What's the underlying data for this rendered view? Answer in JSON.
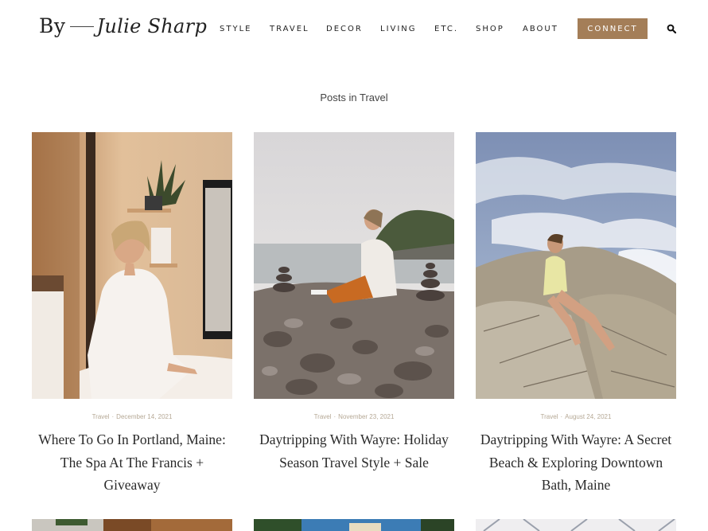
{
  "header": {
    "logo": {
      "by": "By",
      "name": "Julie Sharp"
    },
    "nav": [
      "STYLE",
      "TRAVEL",
      "DECOR",
      "LIVING",
      "ETC.",
      "SHOP",
      "ABOUT"
    ],
    "connect_label": "CONNECT",
    "search_icon": "search-icon"
  },
  "page": {
    "heading": "Posts in Travel"
  },
  "posts": [
    {
      "category": "Travel",
      "date": "December 14, 2021",
      "title": "Where To Go In Portland, Maine: The Spa At The Francis + Giveaway"
    },
    {
      "category": "Travel",
      "date": "November 23, 2021",
      "title": "Daytripping With Wayre: Holiday Season Travel Style + Sale"
    },
    {
      "category": "Travel",
      "date": "August 24, 2021",
      "title": "Daytripping With Wayre: A Secret Beach & Exploring Downtown Bath, Maine"
    }
  ],
  "colors": {
    "accent": "#a47e58",
    "meta": "#b5a895",
    "text": "#222222"
  }
}
